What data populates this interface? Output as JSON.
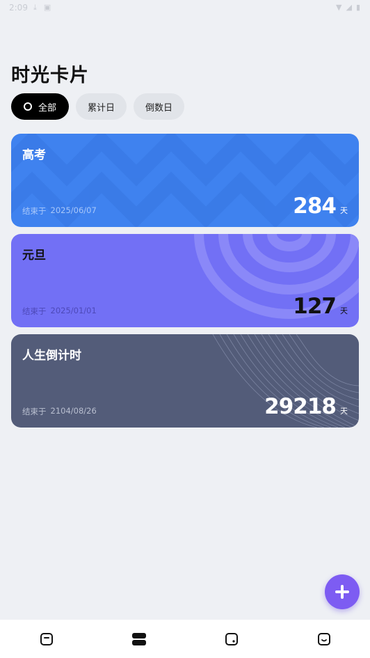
{
  "status_bar": {
    "time": "2:09"
  },
  "title": "时光卡片",
  "filters": [
    {
      "label": "全部",
      "active": true
    },
    {
      "label": "累计日",
      "active": false
    },
    {
      "label": "倒数日",
      "active": false
    }
  ],
  "cards": [
    {
      "title": "高考",
      "end_prefix": "结束于",
      "end_date": "2025/06/07",
      "days": "284",
      "unit": "天",
      "color": "#3f82ef"
    },
    {
      "title": "元旦",
      "end_prefix": "结束于",
      "end_date": "2025/01/01",
      "days": "127",
      "unit": "天",
      "color": "#7270f5"
    },
    {
      "title": "人生倒计时",
      "end_prefix": "结束于",
      "end_date": "2104/08/26",
      "days": "29218",
      "unit": "天",
      "color": "#535c79"
    }
  ],
  "fab": {
    "icon": "plus-icon",
    "color": "#7d5cf2"
  },
  "bottom_nav": [
    {
      "icon": "card-icon",
      "active": false
    },
    {
      "icon": "stack-icon",
      "active": true
    },
    {
      "icon": "square-dot-icon",
      "active": false
    },
    {
      "icon": "smile-icon",
      "active": false
    }
  ]
}
